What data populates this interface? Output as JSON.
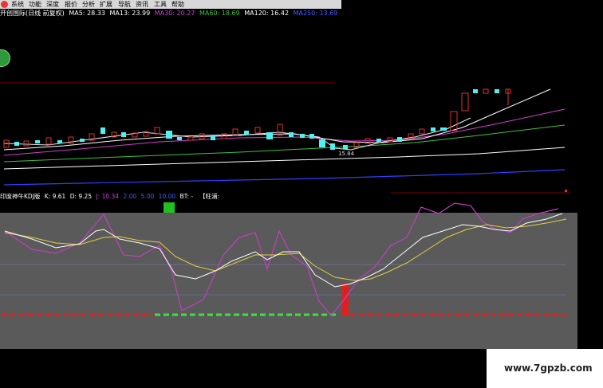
{
  "menu": {
    "items": [
      "系统",
      "功能",
      "深度",
      "报价",
      "分析",
      "扩展",
      "导航",
      "资讯",
      "工具",
      "帮助"
    ]
  },
  "price_legend": {
    "title": "开创国际(日线 前复权)",
    "ma": [
      {
        "label": "MA5: 28.33",
        "color": "#ffffff"
      },
      {
        "label": "MA13: 23.99",
        "color": "#ffffff"
      },
      {
        "label": "MA30: 20.27",
        "color": "#d040d0"
      },
      {
        "label": "MA60: 18.69",
        "color": "#40c040"
      },
      {
        "label": "MA120: 16.42",
        "color": "#ffffff"
      },
      {
        "label": "MA250: 13.69",
        "color": "#4060ff"
      }
    ]
  },
  "low_price_label": "15.84",
  "badge_text": "",
  "kdj_legend": {
    "title": "印度神牛KDJ版",
    "values": [
      {
        "label": "K: 9.61",
        "color": "#ffffff"
      },
      {
        "label": "D: 9.25",
        "color": "#ffffff"
      },
      {
        "label": "J: 10.34",
        "color": "#d040d0"
      },
      {
        "label": "2.00",
        "color": "#4060ff"
      },
      {
        "label": "5.00",
        "color": "#4060ff"
      },
      {
        "label": "10.00",
        "color": "#4060ff"
      },
      {
        "label": "BT: -",
        "color": "#ffffff"
      }
    ]
  },
  "kdj_side_label": "【旺浦:",
  "watermark": "www.7gpzb.com",
  "colors": {
    "bull": "#e03030",
    "bear": "#4ff0f0",
    "ma5": "#ffffff",
    "ma30": "#d040d0",
    "ma60": "#40c040",
    "ma250": "#3040ff",
    "k": "#ffffff",
    "d": "#e0d040",
    "j": "#c040c0",
    "panel": "#5a5a5a"
  }
}
